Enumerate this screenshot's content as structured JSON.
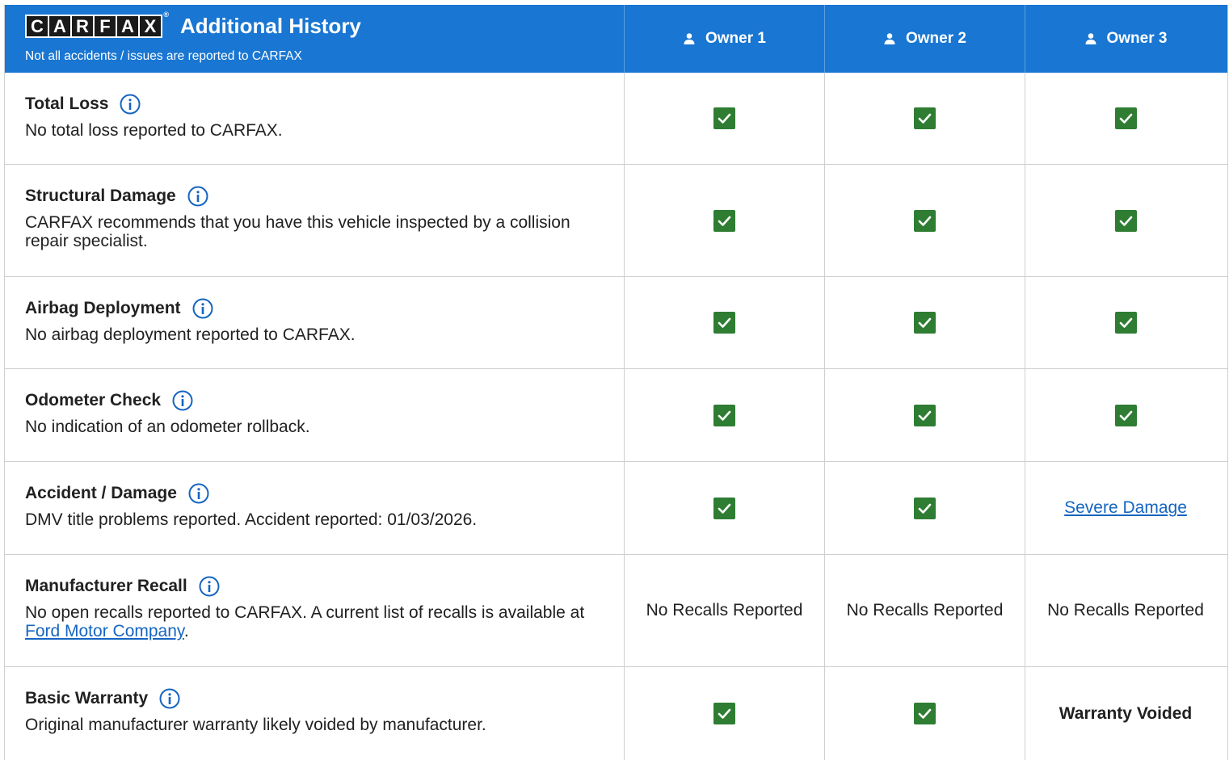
{
  "header": {
    "logo_letters": [
      "C",
      "A",
      "R",
      "F",
      "A",
      "X"
    ],
    "logo_reg": "®",
    "title": "Additional History",
    "subtitle": "Not all accidents / issues are reported to CARFAX",
    "owners": [
      "Owner 1",
      "Owner 2",
      "Owner 3"
    ]
  },
  "colors": {
    "header_bg": "#1976d2",
    "check": "#2e7d32",
    "link": "#1565c0"
  },
  "rows": [
    {
      "title": "Total Loss",
      "text": "No total loss reported to CARFAX.",
      "owners": [
        {
          "type": "check"
        },
        {
          "type": "check"
        },
        {
          "type": "check"
        }
      ]
    },
    {
      "title": "Structural Damage",
      "text": "CARFAX recommends that you have this vehicle inspected by a collision repair specialist.",
      "owners": [
        {
          "type": "check"
        },
        {
          "type": "check"
        },
        {
          "type": "check"
        }
      ]
    },
    {
      "title": "Airbag Deployment",
      "text": "No airbag deployment reported to CARFAX.",
      "owners": [
        {
          "type": "check"
        },
        {
          "type": "check"
        },
        {
          "type": "check"
        }
      ]
    },
    {
      "title": "Odometer Check",
      "text": "No indication of an odometer rollback.",
      "owners": [
        {
          "type": "check"
        },
        {
          "type": "check"
        },
        {
          "type": "check"
        }
      ]
    },
    {
      "title": "Accident / Damage",
      "text": "DMV title problems reported. Accident reported: 01/03/2026.",
      "owners": [
        {
          "type": "check"
        },
        {
          "type": "check"
        },
        {
          "type": "link",
          "text": "Severe Damage"
        }
      ]
    },
    {
      "title": "Manufacturer Recall",
      "text": "No open recalls reported to CARFAX. A current list of recalls is available at ",
      "link": "Ford Motor Company",
      "text_after": ".",
      "owners": [
        {
          "type": "text",
          "text": "No Recalls Reported"
        },
        {
          "type": "text",
          "text": "No Recalls Reported"
        },
        {
          "type": "text",
          "text": "No Recalls Reported"
        }
      ]
    },
    {
      "title": "Basic Warranty",
      "text": "Original manufacturer warranty likely voided by manufacturer.",
      "owners": [
        {
          "type": "check"
        },
        {
          "type": "check"
        },
        {
          "type": "bold",
          "text": "Warranty Voided"
        }
      ]
    }
  ]
}
